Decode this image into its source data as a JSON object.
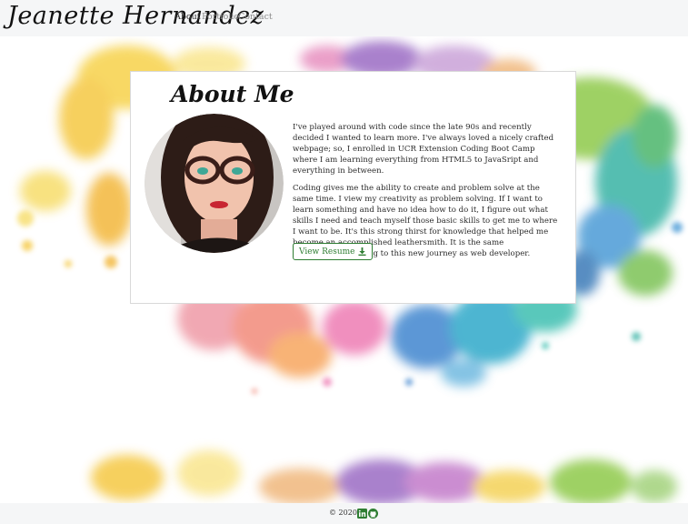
{
  "navbar": {
    "brand": "Jeanette Hernandez",
    "links": [
      {
        "label": "About",
        "active": true
      },
      {
        "label": "Portfolio",
        "active": false
      },
      {
        "label": "Contact",
        "active": false
      }
    ]
  },
  "about": {
    "title": "About Me",
    "paragraphs": [
      "I've played around with code since the late 90s and recently decided I wanted to learn more. I've always loved a nicely crafted webpage; so, I enrolled in UCR Extension Coding Boot Camp where I am learning everything from HTML5 to JavaSript and everything in between.",
      "Coding gives me the ability to create and problem solve at the same time. I view my creativity as problem solving. If I want to learn something and have no idea how to do it, I figure out what skills I need and teach myself those basic skills to get me to where I want to be. It's this strong thirst for knowledge that helped me become an accomplished leathersmith. It is the same determination I bring to this new journey as web developer."
    ],
    "resume_button": "View Resume",
    "resume_icon": "download-icon"
  },
  "footer": {
    "copyright": "© 2020",
    "icons": [
      "linkedin-icon",
      "github-icon"
    ]
  },
  "colors": {
    "accent": "#2e7d32",
    "navbar_bg": "#f5f6f7",
    "nav_active": "#333333",
    "nav_inactive": "#8a8a8a"
  }
}
